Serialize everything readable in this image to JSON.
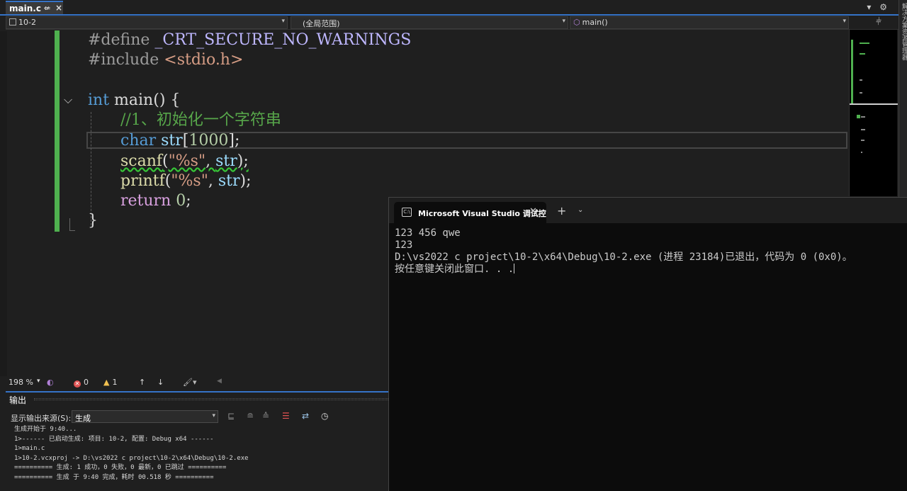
{
  "tab": {
    "filename": "main.c",
    "pin": "⇍",
    "close": "×"
  },
  "tab_right": {
    "dropdown": "▾",
    "settings": "⚙"
  },
  "sidestrip_label": "解决方案资源管理器",
  "navbar": {
    "project": "10-2",
    "scope": "(全局范围)",
    "member": "main()",
    "split": "⫩"
  },
  "code": {
    "l1": {
      "pp": "#define",
      "macro": " _CRT_SECURE_NO_WARNINGS"
    },
    "l2": {
      "pp": "#include",
      "str": " <stdio.h>"
    },
    "l4": {
      "kw": "int",
      "fn": " main",
      "rest": "() {"
    },
    "l5": {
      "cm": "//1、初始化一个字符串"
    },
    "l6": {
      "kw": "char",
      "id": " str",
      "a": "[",
      "num": "1000",
      "b": "];"
    },
    "l7": {
      "fn": "scanf",
      "a": "(",
      "str": "\"%s\"",
      "b": ", ",
      "id": "str",
      "c": ");"
    },
    "l8": {
      "fn": "printf",
      "a": "(",
      "str": "\"%s\"",
      "b": ", ",
      "id": "str",
      "c": ");"
    },
    "l9": {
      "kw": "return",
      "txt": " ",
      "num": "0",
      "end": ";"
    },
    "l10": {
      "txt": "}"
    }
  },
  "edstatus": {
    "zoom": "198 %",
    "errors": "0",
    "warnings": "1",
    "up": "↑",
    "down": "↓"
  },
  "output": {
    "title": "输出",
    "source_label": "显示输出来源(S):",
    "source_value": "生成",
    "log": [
      "生成开始于 9:40...",
      "1>------ 已启动生成: 项目: 10-2, 配置: Debug x64 ------",
      "1>main.c",
      "1>10-2.vcxproj -> D:\\vs2022 c project\\10-2\\x64\\Debug\\10-2.exe",
      "========== 生成: 1 成功，0 失败，0 最新，0 已跳过 ==========",
      "========== 生成 于 9:40 完成，耗时 00.518 秒 =========="
    ]
  },
  "terminal": {
    "tab_title": "Microsoft Visual Studio 调试控",
    "icon": "C:\\",
    "lines": [
      "123 456 qwe",
      "123",
      "D:\\vs2022 c project\\10-2\\x64\\Debug\\10-2.exe (进程 23184)已退出，代码为 0 (0x0)。",
      "按任意键关闭此窗口. . ."
    ]
  }
}
